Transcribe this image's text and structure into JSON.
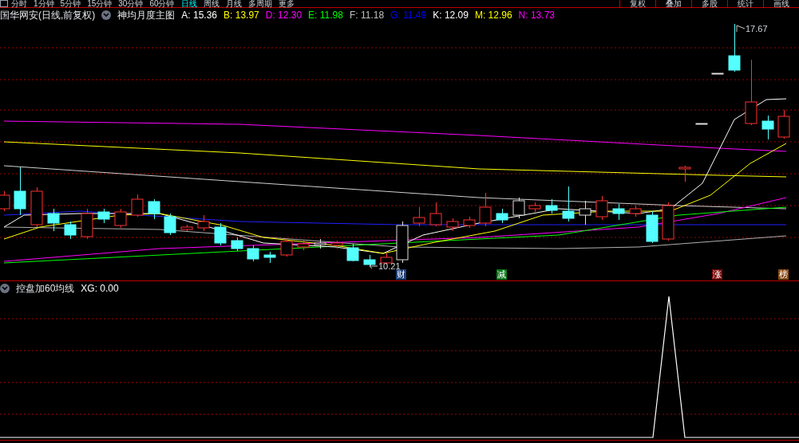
{
  "top_bar": {
    "periods": [
      {
        "label": "分时",
        "selected": false
      },
      {
        "label": "1分钟",
        "selected": false
      },
      {
        "label": "5分钟",
        "selected": false
      },
      {
        "label": "15分钟",
        "selected": false
      },
      {
        "label": "30分钟",
        "selected": false
      },
      {
        "label": "60分钟",
        "selected": false
      },
      {
        "label": "日线",
        "selected": true
      },
      {
        "label": "周线",
        "selected": false
      },
      {
        "label": "月线",
        "selected": false
      },
      {
        "label": "多周期",
        "selected": false
      },
      {
        "label": "更多",
        "selected": false
      }
    ],
    "tools": [
      "复权",
      "叠加",
      "多股",
      "统计",
      "画线"
    ]
  },
  "main_chart": {
    "title": "国华网安(日线,前复权)",
    "indicator": "神均月度主图",
    "values": [
      {
        "label": "A:",
        "value": "15.36",
        "color": "#ffffff"
      },
      {
        "label": "B:",
        "value": "13.97",
        "color": "#ffff00"
      },
      {
        "label": "D:",
        "value": "12.30",
        "color": "#ff00ff"
      },
      {
        "label": "E:",
        "value": "11.98",
        "color": "#00ff00"
      },
      {
        "label": "F:",
        "value": "11.18",
        "color": "#c0c0c0"
      },
      {
        "label": "G:",
        "value": "11.49",
        "color": "#0000ff"
      },
      {
        "label": "K:",
        "value": "12.09",
        "color": "#ffffff"
      },
      {
        "label": "M:",
        "value": "12.96",
        "color": "#ffff00"
      },
      {
        "label": "N:",
        "value": "13.73",
        "color": "#ff00ff"
      }
    ],
    "price_labels": [
      {
        "text": "17.67"
      },
      {
        "text": "10.21"
      }
    ],
    "event_tags": [
      {
        "text": "财",
        "color": "#1c3f78"
      },
      {
        "text": "减",
        "color": "#0a7a1a"
      },
      {
        "text": "涨",
        "color": "#7a0a0a"
      },
      {
        "text": "榜",
        "color": "#8a4a10"
      }
    ]
  },
  "sub_chart": {
    "indicator": "控盘加60均线",
    "values": [
      {
        "label": "XG:",
        "value": "0.00",
        "color": "#ffffff"
      }
    ]
  }
}
